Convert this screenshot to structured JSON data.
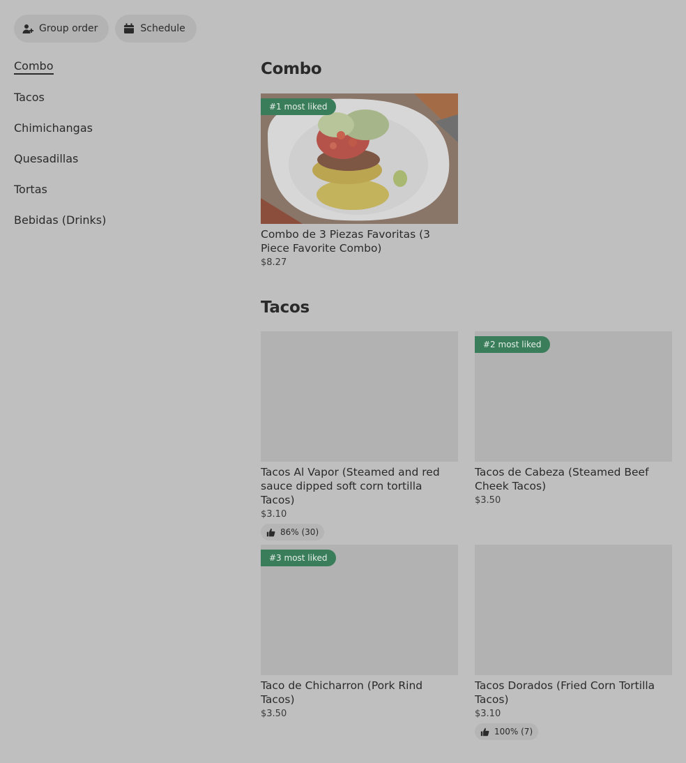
{
  "actions": {
    "group_order": "Group order",
    "schedule": "Schedule"
  },
  "sidebar": {
    "items": [
      {
        "label": "Combo"
      },
      {
        "label": "Tacos"
      },
      {
        "label": "Chimichangas"
      },
      {
        "label": "Quesadillas"
      },
      {
        "label": "Tortas"
      },
      {
        "label": "Bebidas (Drinks)"
      }
    ]
  },
  "sections": {
    "combo": {
      "title": "Combo",
      "items": [
        {
          "badge": "#1 most liked",
          "name": "Combo de 3 Piezas Favoritas (3 Piece Favorite Combo)",
          "price": "$8.27"
        }
      ]
    },
    "tacos": {
      "title": "Tacos",
      "items": [
        {
          "name": "Tacos Al Vapor (Steamed  and red sauce dipped soft corn tortilla Tacos)",
          "price": "$3.10",
          "rating": "86% (30)"
        },
        {
          "badge": "#2 most liked",
          "name": "Tacos de Cabeza (Steamed Beef Cheek Tacos)",
          "price": "$3.50"
        },
        {
          "badge": "#3 most liked",
          "name": "Taco de Chicharron (Pork Rind Tacos)",
          "price": "$3.50"
        },
        {
          "name": "Tacos Dorados (Fried Corn Tortilla Tacos)",
          "price": "$3.10",
          "rating": "100% (7)"
        }
      ]
    }
  },
  "colors": {
    "background": "#bfbfbf",
    "badge": "#3a7d5a",
    "image_placeholder": "#b2b2b2"
  },
  "icons": {
    "group_order": "person-add-icon",
    "schedule": "calendar-icon",
    "rating": "thumbs-up-icon"
  }
}
